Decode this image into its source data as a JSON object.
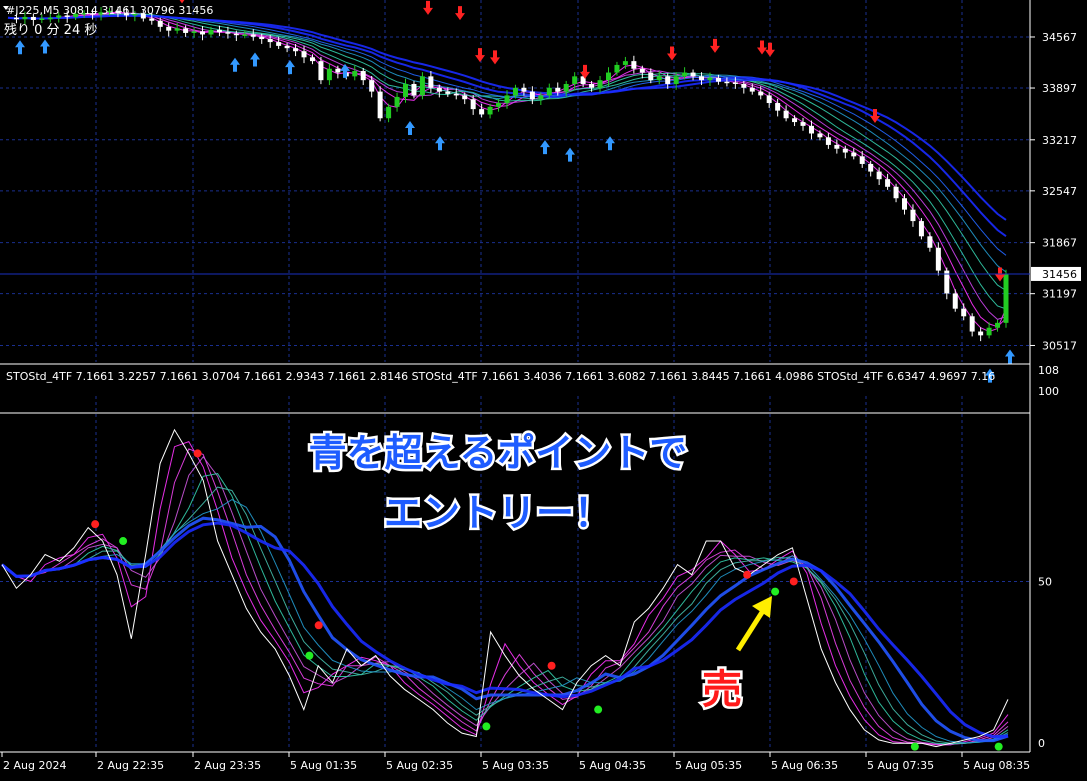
{
  "window": {
    "symbol_header": "#J225,M5  30814 31461 30796 31456",
    "timer_text": "残り 0 分 24 秒",
    "indicator_header": "STOStd_4TF 7.1661 3.2257 7.1661 3.0704 7.1661 2.9343 7.1661 2.8146  STOStd_4TF 7.1661 3.4036 7.1661 3.6082 7.1661 3.8445 7.1661 4.0986  STOStd_4TF 6.6347 4.9697 7.16"
  },
  "annotations": {
    "entry_line1": "青を超えるポイントで",
    "entry_line2": "エントリー！",
    "sell_label": "売"
  },
  "colors": {
    "background": "#000000",
    "grid": "#1a2f8f",
    "bull_candle": "#22cc22",
    "bear_candle": "#ffffff",
    "up_arrow": "#3399ff",
    "down_arrow": "#ff2222",
    "ribbon_blue": "#1a2bff",
    "ribbon_cyan": "#33ccaa",
    "ribbon_magenta": "#ff33ff",
    "stoch_main": "#ffffff",
    "dot_red": "#ff2020",
    "dot_green": "#22ee22",
    "overlay_text": "#1e5cff",
    "sell_text": "#ff1a1a",
    "arrow_yellow": "#ffee00"
  },
  "chart_data": [
    {
      "type": "candlestick",
      "title": "#J225,M5",
      "ylim": [
        30300,
        35000
      ],
      "y_ticks": [
        34567,
        33897,
        33217,
        32547,
        31867,
        31197,
        30517
      ],
      "current_price": 31456,
      "x_ticks": [
        "2 Aug 2024",
        "2 Aug 22:35",
        "2 Aug 23:35",
        "5 Aug 01:35",
        "5 Aug 02:35",
        "5 Aug 03:35",
        "5 Aug 04:35",
        "5 Aug 05:35",
        "5 Aug 06:35",
        "5 Aug 07:35",
        "5 Aug 08:35"
      ],
      "close_path": [
        34820,
        34800,
        34830,
        34790,
        34810,
        34820,
        34850,
        34830,
        34870,
        34880,
        34860,
        34890,
        34910,
        34880,
        34850,
        34870,
        34810,
        34780,
        34700,
        34650,
        34680,
        34620,
        34640,
        34600,
        34660,
        34630,
        34610,
        34590,
        34600,
        34570,
        34540,
        34500,
        34450,
        34420,
        34380,
        34300,
        34250,
        34000,
        34150,
        34100,
        34050,
        34120,
        34000,
        33850,
        33500,
        33650,
        33780,
        33950,
        33800,
        34050,
        33900,
        33850,
        33820,
        33800,
        33750,
        33620,
        33550,
        33650,
        33700,
        33800,
        33900,
        33850,
        33750,
        33800,
        33900,
        33850,
        33950,
        34050,
        33950,
        33900,
        34000,
        34100,
        34200,
        34250,
        34150,
        34100,
        34000,
        34050,
        33950,
        34050,
        34100,
        34050,
        34000,
        34030,
        33980,
        33970,
        33950,
        33900,
        33850,
        33800,
        33700,
        33600,
        33500,
        33450,
        33400,
        33300,
        33250,
        33150,
        33100,
        33050,
        33000,
        32900,
        32800,
        32700,
        32600,
        32450,
        32300,
        32150,
        31950,
        31800,
        31500,
        31200,
        31000,
        30900,
        30700,
        30650,
        30750,
        30814,
        31456
      ],
      "up_arrow_closes": [
        34760,
        34770,
        34530,
        34600,
        34500,
        34450,
        33700,
        33500,
        33450,
        33350,
        33500,
        30450,
        30700
      ],
      "down_arrow_closes": [
        34850,
        34900,
        34700,
        34630,
        34080,
        34050,
        33860,
        34100,
        34200,
        34180,
        34150,
        33280,
        31200
      ],
      "ribbon": "moving-average fan (blue / cyan / magenta)"
    },
    {
      "type": "line",
      "title": "STOStd_4TF",
      "ylim": [
        0,
        108
      ],
      "y_ticks": [
        108,
        100,
        50,
        0
      ],
      "main_line": [
        55,
        48,
        52,
        58,
        56,
        60,
        66,
        62,
        52,
        33,
        58,
        85,
        95,
        88,
        80,
        62,
        52,
        42,
        35,
        30,
        22,
        12,
        25,
        20,
        30,
        25,
        28,
        22,
        18,
        15,
        12,
        8,
        5,
        4,
        35,
        28,
        22,
        18,
        15,
        12,
        20,
        25,
        28,
        25,
        38,
        42,
        48,
        55,
        52,
        62,
        62,
        54,
        52,
        55,
        58,
        60,
        45,
        30,
        20,
        12,
        6,
        3,
        2,
        2,
        2,
        1,
        2,
        3,
        4,
        6,
        15
      ],
      "signal_dots": [
        {
          "x": 10,
          "y": 67,
          "kind": "red"
        },
        {
          "x": 13,
          "y": 62,
          "kind": "green"
        },
        {
          "x": 21,
          "y": 88,
          "kind": "red"
        },
        {
          "x": 33,
          "y": 28,
          "kind": "green"
        },
        {
          "x": 34,
          "y": 37,
          "kind": "red"
        },
        {
          "x": 52,
          "y": 7,
          "kind": "green"
        },
        {
          "x": 59,
          "y": 25,
          "kind": "red"
        },
        {
          "x": 64,
          "y": 12,
          "kind": "green"
        },
        {
          "x": 80,
          "y": 52,
          "kind": "red"
        },
        {
          "x": 83,
          "y": 47,
          "kind": "green"
        },
        {
          "x": 85,
          "y": 50,
          "kind": "red"
        },
        {
          "x": 98,
          "y": 1,
          "kind": "green"
        },
        {
          "x": 107,
          "y": 1,
          "kind": "green"
        }
      ]
    }
  ]
}
